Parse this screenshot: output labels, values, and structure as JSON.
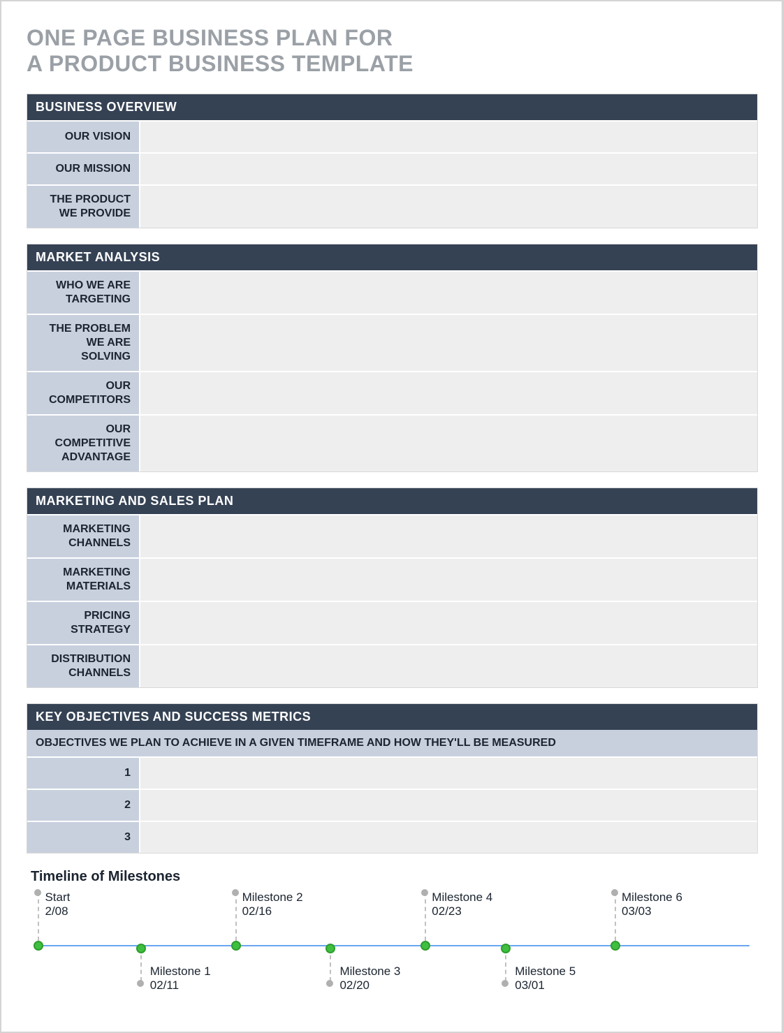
{
  "title_line1": "ONE PAGE BUSINESS PLAN FOR",
  "title_line2": "A PRODUCT BUSINESS TEMPLATE",
  "sections": {
    "business_overview": {
      "header": "BUSINESS OVERVIEW",
      "rows": [
        {
          "label": "OUR VISION",
          "value": ""
        },
        {
          "label": "OUR MISSION",
          "value": ""
        },
        {
          "label": "THE PRODUCT WE PROVIDE",
          "value": ""
        }
      ]
    },
    "market_analysis": {
      "header": "MARKET ANALYSIS",
      "rows": [
        {
          "label": "WHO WE ARE TARGETING",
          "value": ""
        },
        {
          "label": "THE PROBLEM WE ARE SOLVING",
          "value": ""
        },
        {
          "label": "OUR COMPETITORS",
          "value": ""
        },
        {
          "label": "OUR COMPETITIVE ADVANTAGE",
          "value": ""
        }
      ]
    },
    "marketing_sales": {
      "header": "MARKETING AND SALES PLAN",
      "rows": [
        {
          "label": "MARKETING CHANNELS",
          "value": ""
        },
        {
          "label": "MARKETING MATERIALS",
          "value": ""
        },
        {
          "label": "PRICING STRATEGY",
          "value": ""
        },
        {
          "label": "DISTRIBUTION CHANNELS",
          "value": ""
        }
      ]
    },
    "key_objectives": {
      "header": "KEY OBJECTIVES AND SUCCESS METRICS",
      "subheader": "OBJECTIVES WE PLAN TO ACHIEVE IN A GIVEN TIMEFRAME AND HOW THEY'LL BE MEASURED",
      "rows": [
        {
          "label": "1",
          "value": ""
        },
        {
          "label": "2",
          "value": ""
        },
        {
          "label": "3",
          "value": ""
        }
      ]
    }
  },
  "timeline": {
    "title": "Timeline of Milestones",
    "milestones": [
      {
        "name": "Start",
        "date": "2/08",
        "side": "top",
        "pct": 1
      },
      {
        "name": "Milestone 1",
        "date": "02/11",
        "side": "bottom",
        "pct": 15
      },
      {
        "name": "Milestone 2",
        "date": "02/16",
        "side": "top",
        "pct": 28
      },
      {
        "name": "Milestone 3",
        "date": "02/20",
        "side": "bottom",
        "pct": 41
      },
      {
        "name": "Milestone 4",
        "date": "02/23",
        "side": "top",
        "pct": 54
      },
      {
        "name": "Milestone 5",
        "date": "03/01",
        "side": "bottom",
        "pct": 65
      },
      {
        "name": "Milestone 6",
        "date": "03/03",
        "side": "top",
        "pct": 80
      }
    ]
  }
}
